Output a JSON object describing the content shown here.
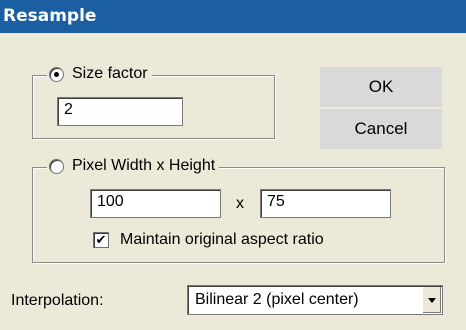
{
  "window": {
    "title": "Resample"
  },
  "size_factor": {
    "label": "Size factor",
    "selected": true,
    "value": "2"
  },
  "pixel_size": {
    "label": "Pixel Width x Height",
    "selected": false,
    "width": "100",
    "separator": "x",
    "height": "75",
    "aspect_label": "Maintain original aspect ratio",
    "aspect_checked": true,
    "check_glyph": "✔"
  },
  "buttons": {
    "ok": "OK",
    "cancel": "Cancel"
  },
  "interpolation": {
    "label": "Interpolation:",
    "selected": "Bilinear 2 (pixel center)"
  }
}
